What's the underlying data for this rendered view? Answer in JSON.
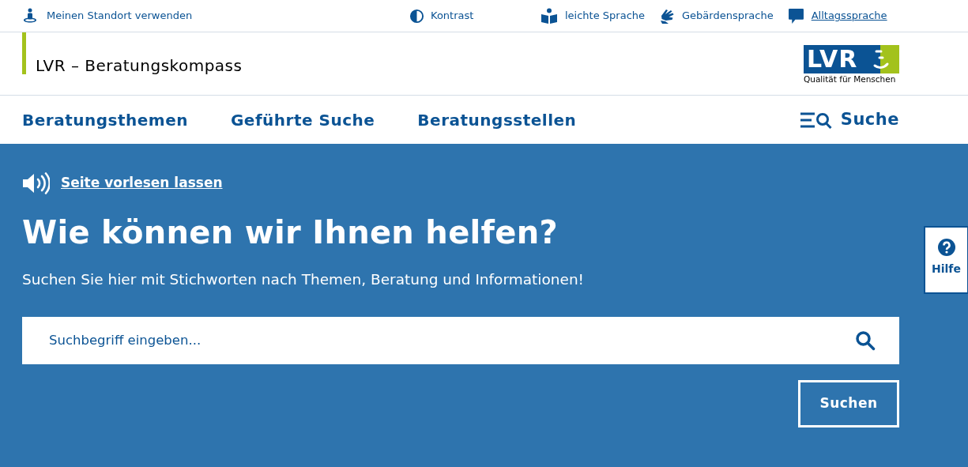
{
  "utility_bar": {
    "location": "Meinen Standort verwenden",
    "contrast": "Kontrast",
    "languages": [
      {
        "kind": "easy",
        "label": "leichte Sprache",
        "selected": false
      },
      {
        "kind": "sign",
        "label": "Gebärdensprache",
        "selected": false
      },
      {
        "kind": "everyday",
        "label": "Alltagssprache",
        "selected": true
      }
    ]
  },
  "header": {
    "title": "LVR – Beratungskompass",
    "logo": {
      "mark": "LVR",
      "tagline": "Qualität für Menschen"
    }
  },
  "nav": {
    "items": [
      "Beratungsthemen",
      "Geführte Suche",
      "Beratungsstellen"
    ],
    "search": "Suche"
  },
  "hero": {
    "read_aloud": "Seite vorlesen lassen",
    "heading": "Wie können wir Ihnen helfen?",
    "subheading": "Suchen Sie hier mit Stichworten nach Themen, Beratung und Informationen!",
    "search_placeholder": "Suchbegriff eingeben...",
    "button": "Suchen",
    "help": "Hilfe"
  }
}
